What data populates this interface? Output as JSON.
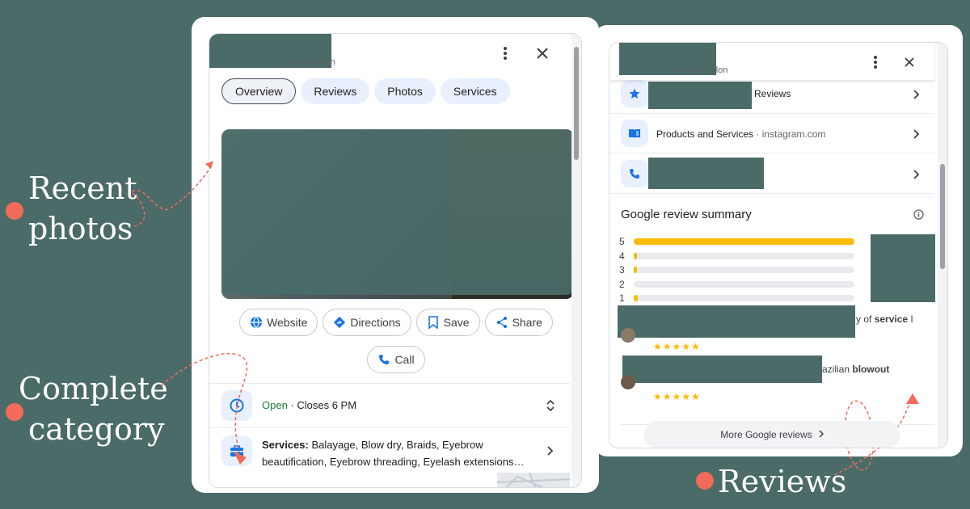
{
  "annotations": {
    "recent_photos": [
      "Recent",
      "photos"
    ],
    "complete_category": [
      "Complete",
      "category"
    ],
    "reviews": "Reviews"
  },
  "left_panel": {
    "category": "Beauty salon",
    "tabs": [
      "Overview",
      "Reviews",
      "Photos",
      "Services"
    ],
    "actions": [
      "Website",
      "Directions",
      "Save",
      "Share",
      "Call"
    ],
    "hours": {
      "status": "Open",
      "detail": " · Closes 6 PM"
    },
    "services": {
      "label": "Services:",
      "line1": " Balayage, Blow dry, Braids, Eyebrow",
      "line2": "beautification, Eyebrow threading, Eyelash extensions…"
    }
  },
  "right_panel": {
    "category": "· Beauty salon",
    "rows": {
      "reviews": "Reviews",
      "products": "Products and Services",
      "products_site": "· instagram.com"
    },
    "summary_title": "Google review summary",
    "rating_bars": [
      {
        "label": "5",
        "fill": 1.0
      },
      {
        "label": "4",
        "fill": 0.01
      },
      {
        "label": "3",
        "fill": 0.01
      },
      {
        "label": "2",
        "fill": 0.0
      },
      {
        "label": "1",
        "fill": 0.02
      }
    ],
    "review1": {
      "visible_text": "y of ",
      "bold": "service",
      "tail": " I",
      "stars": "★★★★★"
    },
    "review2": {
      "visible_text": "azilian ",
      "bold": "blowout",
      "stars": "★★★★★"
    },
    "more_button": "More Google reviews"
  },
  "colors": {
    "accent": "#1a73e8",
    "annotation": "#f26a5a",
    "star": "#fbbc04",
    "open": "#188038",
    "background": "#4a6b68"
  }
}
